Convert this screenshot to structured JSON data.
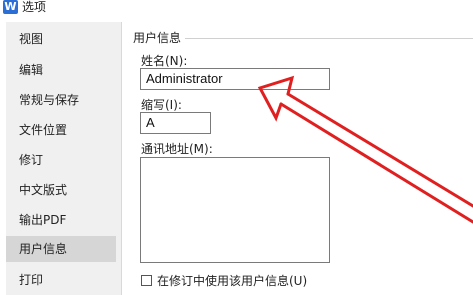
{
  "window": {
    "title": "选项",
    "icon": "wps-writer-icon"
  },
  "sidebar": {
    "items": [
      {
        "label": "视图"
      },
      {
        "label": "编辑"
      },
      {
        "label": "常规与保存"
      },
      {
        "label": "文件位置"
      },
      {
        "label": "修订"
      },
      {
        "label": "中文版式"
      },
      {
        "label": "输出PDF"
      },
      {
        "label": "用户信息",
        "active": true
      },
      {
        "label": "打印"
      }
    ]
  },
  "user_info": {
    "group_title": "用户信息",
    "name_label": "姓名(N):",
    "name_value": "Administrator",
    "initials_label": "缩写(I):",
    "initials_value": "A",
    "address_label": "通讯地址(M):",
    "address_value": "",
    "use_in_revision_label": "在修订中使用该用户信息(U)",
    "use_in_revision_checked": false
  },
  "annotation": {
    "arrow_color": "#e02020"
  }
}
